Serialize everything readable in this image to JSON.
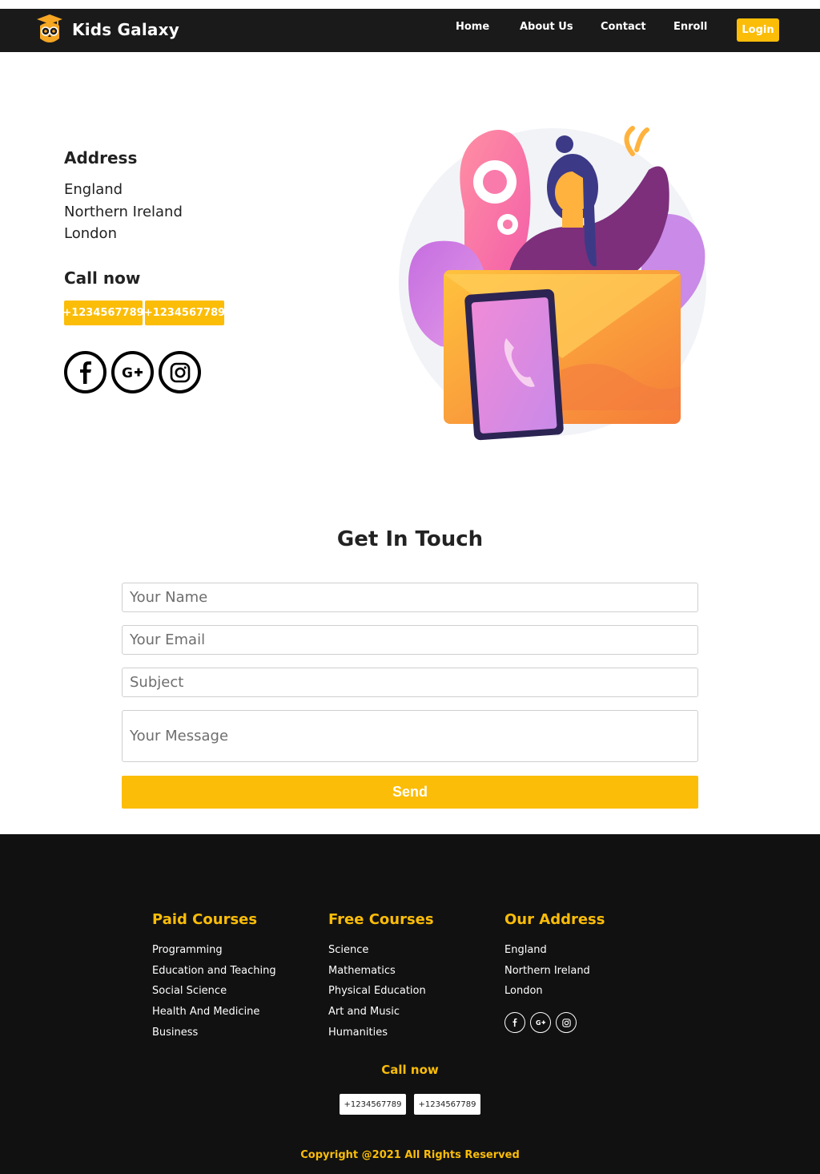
{
  "brand": {
    "name": "Kids Galaxy"
  },
  "nav": {
    "links": [
      "Home",
      "About Us",
      "Contact",
      "Enroll"
    ],
    "login_label": "Login"
  },
  "contact": {
    "address_heading": "Address",
    "address_lines": [
      "England",
      "Northern Ireland",
      "London"
    ],
    "call_heading": "Call now",
    "phones": [
      "+1234567789",
      "+1234567789"
    ],
    "social_icons": [
      "facebook-icon",
      "google-plus-icon",
      "instagram-icon"
    ]
  },
  "form": {
    "title": "Get In Touch",
    "name_placeholder": "Your Name",
    "email_placeholder": "Your Email",
    "subject_placeholder": "Subject",
    "message_placeholder": "Your Message",
    "send_label": "Send"
  },
  "footer": {
    "paid": {
      "heading": "Paid Courses",
      "items": [
        "Programming",
        "Education and Teaching",
        "Social Science",
        "Health And Medicine",
        "Business"
      ]
    },
    "free": {
      "heading": "Free Courses",
      "items": [
        "Science",
        "Mathematics",
        "Physical Education",
        "Art and Music",
        "Humanities"
      ]
    },
    "address": {
      "heading": "Our Address",
      "items": [
        "England",
        "Northern Ireland",
        "London"
      ]
    },
    "call_heading": "Call now",
    "phones": [
      "+1234567789",
      "+1234567789"
    ],
    "copyright": "Copyright @2021 All Rights Reserved"
  },
  "colors": {
    "accent": "#fbbd08",
    "nav_bg": "#1a1a1a",
    "footer_bg": "#111111"
  }
}
